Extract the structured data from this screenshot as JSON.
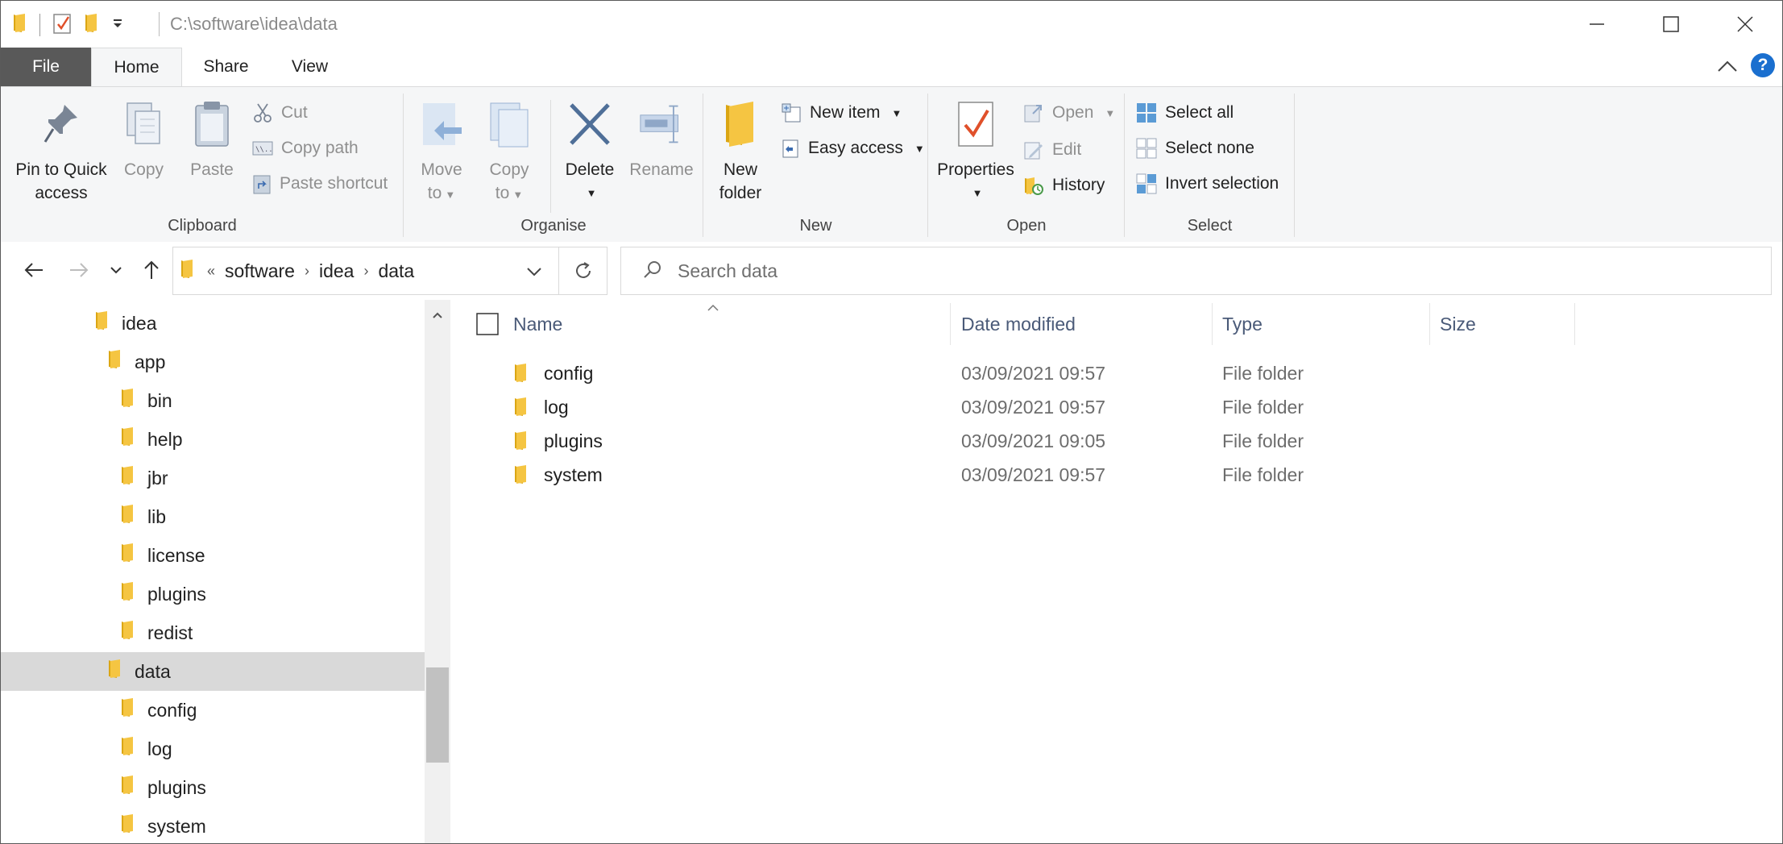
{
  "window": {
    "title_path": "C:\\software\\idea\\data"
  },
  "tabs": [
    {
      "label": "File"
    },
    {
      "label": "Home"
    },
    {
      "label": "Share"
    },
    {
      "label": "View"
    }
  ],
  "ribbon": {
    "clipboard": {
      "label": "Clipboard",
      "pin_line1": "Pin to Quick",
      "pin_line2": "access",
      "copy": "Copy",
      "paste": "Paste",
      "cut": "Cut",
      "copy_path": "Copy path",
      "paste_shortcut": "Paste shortcut"
    },
    "organise": {
      "label": "Organise",
      "move_line1": "Move",
      "move_line2": "to",
      "copy_line1": "Copy",
      "copy_line2": "to",
      "delete": "Delete",
      "rename": "Rename"
    },
    "new": {
      "label": "New",
      "new_folder_line1": "New",
      "new_folder_line2": "folder",
      "new_item": "New item",
      "easy_access": "Easy access"
    },
    "open": {
      "label": "Open",
      "properties": "Properties",
      "open": "Open",
      "edit": "Edit",
      "history": "History"
    },
    "select": {
      "label": "Select",
      "select_all": "Select all",
      "select_none": "Select none",
      "invert_selection": "Invert selection"
    }
  },
  "address": {
    "overflow": "«",
    "crumbs": [
      "software",
      "idea",
      "data"
    ]
  },
  "search": {
    "placeholder": "Search data"
  },
  "tree": [
    {
      "label": "idea",
      "indent": 0
    },
    {
      "label": "app",
      "indent": 1
    },
    {
      "label": "bin",
      "indent": 2
    },
    {
      "label": "help",
      "indent": 2
    },
    {
      "label": "jbr",
      "indent": 2
    },
    {
      "label": "lib",
      "indent": 2
    },
    {
      "label": "license",
      "indent": 2
    },
    {
      "label": "plugins",
      "indent": 2
    },
    {
      "label": "redist",
      "indent": 2
    },
    {
      "label": "data",
      "indent": 1,
      "selected": true
    },
    {
      "label": "config",
      "indent": 2
    },
    {
      "label": "log",
      "indent": 2
    },
    {
      "label": "plugins",
      "indent": 2
    },
    {
      "label": "system",
      "indent": 2
    }
  ],
  "columns": {
    "name": "Name",
    "date": "Date modified",
    "type": "Type",
    "size": "Size"
  },
  "files": [
    {
      "name": "config",
      "date": "03/09/2021 09:57",
      "type": "File folder",
      "size": ""
    },
    {
      "name": "log",
      "date": "03/09/2021 09:57",
      "type": "File folder",
      "size": ""
    },
    {
      "name": "plugins",
      "date": "03/09/2021 09:05",
      "type": "File folder",
      "size": ""
    },
    {
      "name": "system",
      "date": "03/09/2021 09:57",
      "type": "File folder",
      "size": ""
    }
  ],
  "colors": {
    "folder": "#f5c542",
    "folder_dark": "#dba614",
    "accent_blue": "#1a6fcf",
    "file_tab": "#595959",
    "selection": "#d9d9d9"
  }
}
